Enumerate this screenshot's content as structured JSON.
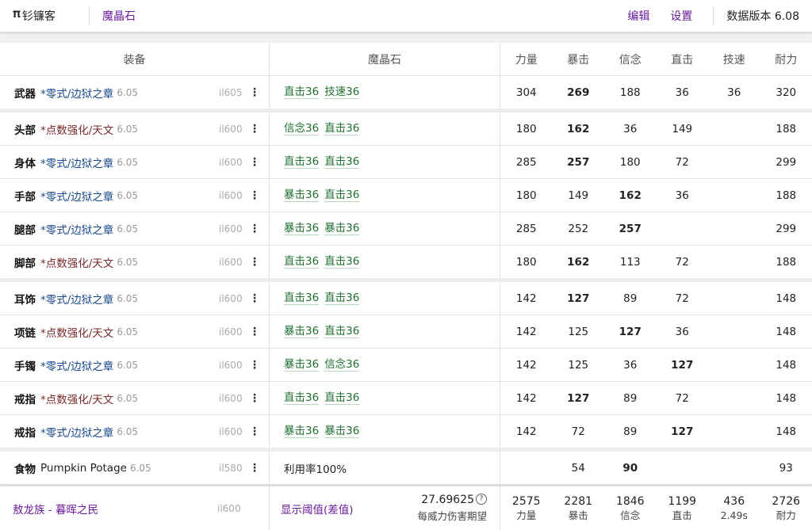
{
  "header": {
    "logo_icon": "scythe-icon",
    "app_name": "钐镰客",
    "section_link": "魔晶石",
    "edit_label": "编辑",
    "settings_label": "设置",
    "version": "数据版本 6.08",
    "accent_color": "#6a1b9a"
  },
  "table": {
    "headers": {
      "equip": "装备",
      "materia": "魔晶石",
      "stats": [
        "力量",
        "暴击",
        "信念",
        "直击",
        "技速",
        "耐力"
      ]
    },
    "rows": [
      {
        "slot": "武器",
        "name": "*零式/边狱之章",
        "name_color": "blue",
        "ver": "6.05",
        "il": "il605",
        "menu": "⋮",
        "materia": [
          "直击36",
          "技速36"
        ],
        "stats": [
          "304",
          "269",
          "188",
          "36",
          "36",
          "320"
        ],
        "bold": [
          1
        ],
        "gap": true
      },
      {
        "slot": "头部",
        "name": "*点数强化/天文",
        "name_color": "red",
        "ver": "6.05",
        "il": "il600",
        "menu": "⋮",
        "materia": [
          "信念36",
          "直击36"
        ],
        "stats": [
          "180",
          "162",
          "36",
          "149",
          "",
          "188"
        ],
        "bold": [
          1
        ],
        "gap": false
      },
      {
        "slot": "身体",
        "name": "*零式/边狱之章",
        "name_color": "blue",
        "ver": "6.05",
        "il": "il600",
        "menu": "⋮",
        "materia": [
          "直击36",
          "直击36"
        ],
        "stats": [
          "285",
          "257",
          "180",
          "72",
          "",
          "299"
        ],
        "bold": [
          1
        ],
        "gap": false
      },
      {
        "slot": "手部",
        "name": "*零式/边狱之章",
        "name_color": "blue",
        "ver": "6.05",
        "il": "il600",
        "menu": "⋮",
        "materia": [
          "暴击36",
          "直击36"
        ],
        "stats": [
          "180",
          "149",
          "162",
          "36",
          "",
          "188"
        ],
        "bold": [
          2
        ],
        "gap": false
      },
      {
        "slot": "腿部",
        "name": "*零式/边狱之章",
        "name_color": "blue",
        "ver": "6.05",
        "il": "il600",
        "menu": "⋮",
        "materia": [
          "暴击36",
          "暴击36"
        ],
        "stats": [
          "285",
          "252",
          "257",
          "",
          "",
          "299"
        ],
        "bold": [
          2
        ],
        "gap": false
      },
      {
        "slot": "脚部",
        "name": "*点数强化/天文",
        "name_color": "red",
        "ver": "6.05",
        "il": "il600",
        "menu": "⋮",
        "materia": [
          "直击36",
          "直击36"
        ],
        "stats": [
          "180",
          "162",
          "113",
          "72",
          "",
          "188"
        ],
        "bold": [
          1
        ],
        "gap": true
      },
      {
        "slot": "耳饰",
        "name": "*零式/边狱之章",
        "name_color": "blue",
        "ver": "6.05",
        "il": "il600",
        "menu": "⋮",
        "materia": [
          "直击36",
          "直击36"
        ],
        "stats": [
          "142",
          "127",
          "89",
          "72",
          "",
          "148"
        ],
        "bold": [
          1
        ],
        "gap": false
      },
      {
        "slot": "项链",
        "name": "*点数强化/天文",
        "name_color": "red",
        "ver": "6.05",
        "il": "il600",
        "menu": "⋮",
        "materia": [
          "暴击36",
          "直击36"
        ],
        "stats": [
          "142",
          "125",
          "127",
          "36",
          "",
          "148"
        ],
        "bold": [
          2
        ],
        "gap": false
      },
      {
        "slot": "手镯",
        "name": "*零式/边狱之章",
        "name_color": "blue",
        "ver": "6.05",
        "il": "il600",
        "menu": "⋮",
        "materia": [
          "暴击36",
          "信念36"
        ],
        "stats": [
          "142",
          "125",
          "36",
          "127",
          "",
          "148"
        ],
        "bold": [
          3
        ],
        "gap": false
      },
      {
        "slot": "戒指",
        "name": "*点数强化/天文",
        "name_color": "red",
        "ver": "6.05",
        "il": "il600",
        "menu": "⋮",
        "materia": [
          "直击36",
          "直击36"
        ],
        "stats": [
          "142",
          "127",
          "89",
          "72",
          "",
          "148"
        ],
        "bold": [
          1
        ],
        "gap": false
      },
      {
        "slot": "戒指",
        "name": "*零式/边狱之章",
        "name_color": "blue",
        "ver": "6.05",
        "il": "il600",
        "menu": "⋮",
        "materia": [
          "暴击36",
          "暴击36"
        ],
        "stats": [
          "142",
          "72",
          "89",
          "127",
          "",
          "148"
        ],
        "bold": [
          3
        ],
        "gap": true
      },
      {
        "slot": "食物",
        "name": "Pumpkin Potage",
        "name_color": "plain",
        "ver": "6.05",
        "il": "il580",
        "menu": "⋮",
        "materia_text": "利用率100%",
        "stats": [
          "",
          "54",
          "90",
          "",
          "",
          "93"
        ],
        "bold": [
          2
        ],
        "gap": false
      }
    ]
  },
  "footer": {
    "race": "敖龙族 - 暮晖之民",
    "il": "il600",
    "threshold_link": "显示阈值(差值)",
    "expected_value": "27.69625",
    "help_icon": "question-circle-icon",
    "expected_label": "每威力伤害期望",
    "totals": [
      {
        "value": "2575",
        "label": "力量"
      },
      {
        "value": "2281",
        "label": "暴击"
      },
      {
        "value": "1846",
        "label": "信念"
      },
      {
        "value": "1199",
        "label": "直击"
      },
      {
        "value": "436",
        "label": "2.49s"
      },
      {
        "value": "2726",
        "label": "耐力"
      }
    ]
  }
}
